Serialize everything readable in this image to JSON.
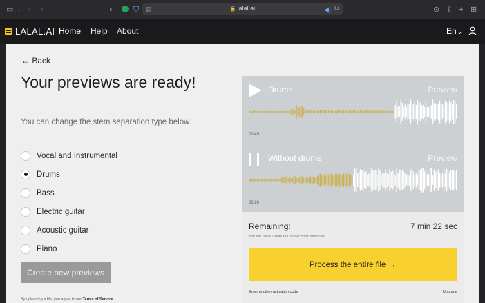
{
  "browser": {
    "url": "lalal.ai",
    "icons": [
      "sidebar-icon",
      "chevron-down-icon",
      "back-arrow-icon",
      "forward-arrow-icon",
      "shield-icon",
      "grammarly-icon",
      "extension-icon",
      "reader-icon",
      "lock-icon",
      "speaker-icon",
      "reload-icon",
      "download-icon",
      "share-icon",
      "new-tab-icon",
      "tab-overview-icon"
    ]
  },
  "header": {
    "logo": "LALAL.AI",
    "nav": [
      "Home",
      "Help",
      "About"
    ],
    "language": "En"
  },
  "main": {
    "back_label": "← Back",
    "title": "Your previews are ready!",
    "subtitle": "You can change the stem separation type below",
    "options": [
      {
        "label": "Vocal and Instrumental",
        "checked": false
      },
      {
        "label": "Drums",
        "checked": true
      },
      {
        "label": "Bass",
        "checked": false
      },
      {
        "label": "Electric guitar",
        "checked": false
      },
      {
        "label": "Acoustic guitar",
        "checked": false
      },
      {
        "label": "Piano",
        "checked": false
      }
    ],
    "create_button": "Create new previews",
    "tos_prefix": "By uploading a file, you agree to our ",
    "tos_link": "Terms of Service"
  },
  "preview": {
    "tracks": [
      {
        "name": "Drums",
        "preview_label": "Preview",
        "time": "00:45",
        "state": "stopped",
        "progress": 0.0
      },
      {
        "name": "Without drums",
        "preview_label": "Preview",
        "time": "00:29",
        "state": "playing",
        "progress": 0.5
      }
    ],
    "remaining_label": "Remaining:",
    "remaining_time": "7 min 22 sec",
    "deduct_note": "You will have 2 minutes 38 seconds deducted",
    "process_button": "Process the entire file →",
    "activation_link": "Enter another activation code",
    "upgrade_link": "Upgrade"
  },
  "colors": {
    "accent": "#f8d12f",
    "wave_played": "#c9b45a",
    "wave_unplayed": "#ffffff",
    "track_bg": "#cdd0d2"
  }
}
